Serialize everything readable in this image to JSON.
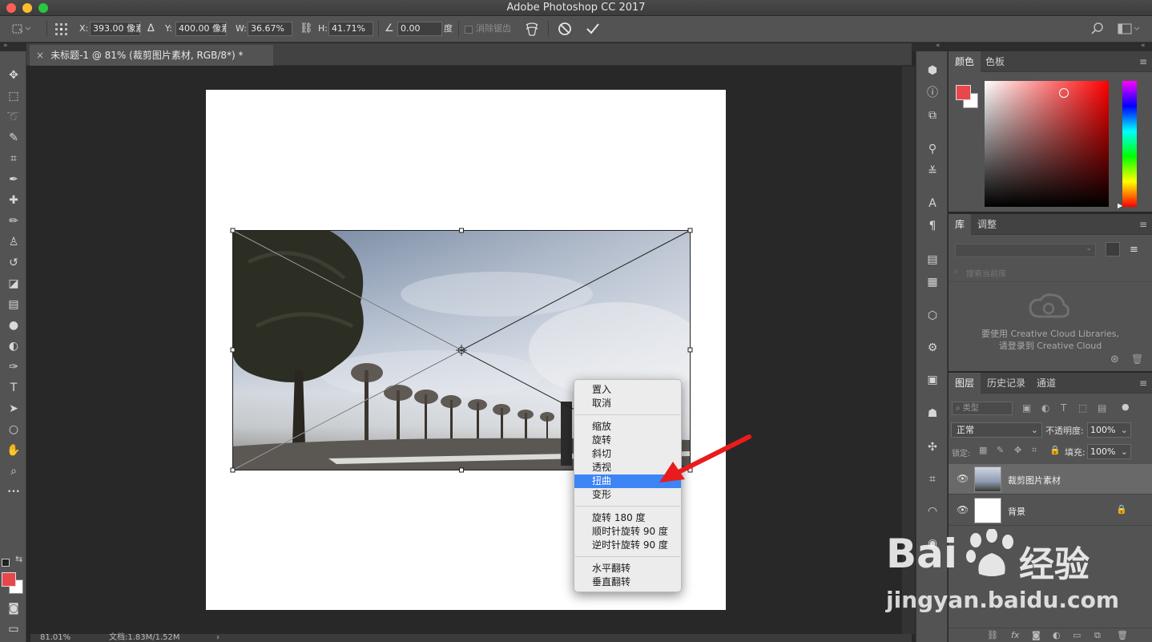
{
  "app": {
    "title": "Adobe Photoshop CC 2017"
  },
  "window_controls": {
    "close_color": "#fc5f57",
    "minimize_color": "#fdbc2e",
    "zoom_color": "#28c840"
  },
  "options_bar": {
    "x_label": "X:",
    "x_value": "393.00 像素",
    "y_label": "Y:",
    "y_value": "400.00 像素",
    "w_label": "W:",
    "w_value": "36.67%",
    "h_label": "H:",
    "h_value": "41.71%",
    "angle_value": "0.00",
    "angle_unit": "度",
    "antialias_label": "消除锯齿"
  },
  "document": {
    "tab_title": "未标题-1 @ 81% (裁剪图片素材, RGB/8*) *",
    "close_glyph": "×"
  },
  "tools": [
    {
      "name": "move-tool-icon",
      "glyph": "✥"
    },
    {
      "name": "marquee-tool-icon",
      "glyph": "⬚"
    },
    {
      "name": "lasso-tool-icon",
      "glyph": "➰"
    },
    {
      "name": "quick-select-tool-icon",
      "glyph": "✎"
    },
    {
      "name": "crop-tool-icon",
      "glyph": "⌗"
    },
    {
      "name": "eyedropper-tool-icon",
      "glyph": "✒"
    },
    {
      "name": "healing-tool-icon",
      "glyph": "✚"
    },
    {
      "name": "brush-tool-icon",
      "glyph": "✏"
    },
    {
      "name": "stamp-tool-icon",
      "glyph": "♙"
    },
    {
      "name": "history-brush-tool-icon",
      "glyph": "↺"
    },
    {
      "name": "eraser-tool-icon",
      "glyph": "◪"
    },
    {
      "name": "gradient-tool-icon",
      "glyph": "▤"
    },
    {
      "name": "blur-tool-icon",
      "glyph": "●"
    },
    {
      "name": "dodge-tool-icon",
      "glyph": "◐"
    },
    {
      "name": "pen-tool-icon",
      "glyph": "✑"
    },
    {
      "name": "type-tool-icon",
      "glyph": "T"
    },
    {
      "name": "path-select-tool-icon",
      "glyph": "➤"
    },
    {
      "name": "ellipse-tool-icon",
      "glyph": "○"
    },
    {
      "name": "hand-tool-icon",
      "glyph": "✋"
    },
    {
      "name": "zoom-tool-icon",
      "glyph": "⌕"
    },
    {
      "name": "more-tools-icon",
      "glyph": "•••"
    }
  ],
  "colors": {
    "foreground": "#e8474b",
    "background": "#ffffff",
    "selection_blue": "#3d84f5",
    "arrow_red": "#e81c1c"
  },
  "context_menu": {
    "items": [
      "置入",
      "取消",
      "缩放",
      "旋转",
      "斜切",
      "透视",
      "扭曲",
      "变形",
      "旋转 180 度",
      "顺时针旋转 90 度",
      "逆时针旋转 90 度",
      "水平翻转",
      "垂直翻转"
    ],
    "selected": "扭曲"
  },
  "status": {
    "zoom": "81.01%",
    "doc": "文档:1.83M/1.52M",
    "chevron": "›"
  },
  "color_panel": {
    "tabs": [
      "颜色",
      "色板"
    ],
    "active_tab": "颜色",
    "menu_glyph": "≡"
  },
  "library_panel": {
    "tabs": [
      "库",
      "调整"
    ],
    "active_tab": "库",
    "search_placeholder": "搜索当前库",
    "message_line1": "要使用 Creative Cloud Libraries,",
    "message_line2": "请登录到 Creative Cloud"
  },
  "layers_panel": {
    "tabs": [
      "图层",
      "历史记录",
      "通道"
    ],
    "active_tab": "图层",
    "filter_label": "类型",
    "blend_mode": "正常",
    "opacity_label": "不透明度:",
    "opacity_value": "100%",
    "lock_label": "锁定:",
    "fill_label": "填充:",
    "fill_value": "100%",
    "layers": [
      {
        "name": "裁剪图片素材",
        "visible": true,
        "selected": true
      },
      {
        "name": "背景",
        "visible": true,
        "selected": false,
        "locked": true
      }
    ],
    "footer_icons": [
      "link-icon",
      "fx-icon",
      "mask-icon",
      "adjustment-icon",
      "group-icon",
      "new-layer-icon",
      "trash-icon"
    ],
    "fx_text": "fx"
  },
  "watermark": {
    "brand_left": "Bai",
    "brand_right": "经验",
    "url": "jingyan.baidu.com"
  }
}
